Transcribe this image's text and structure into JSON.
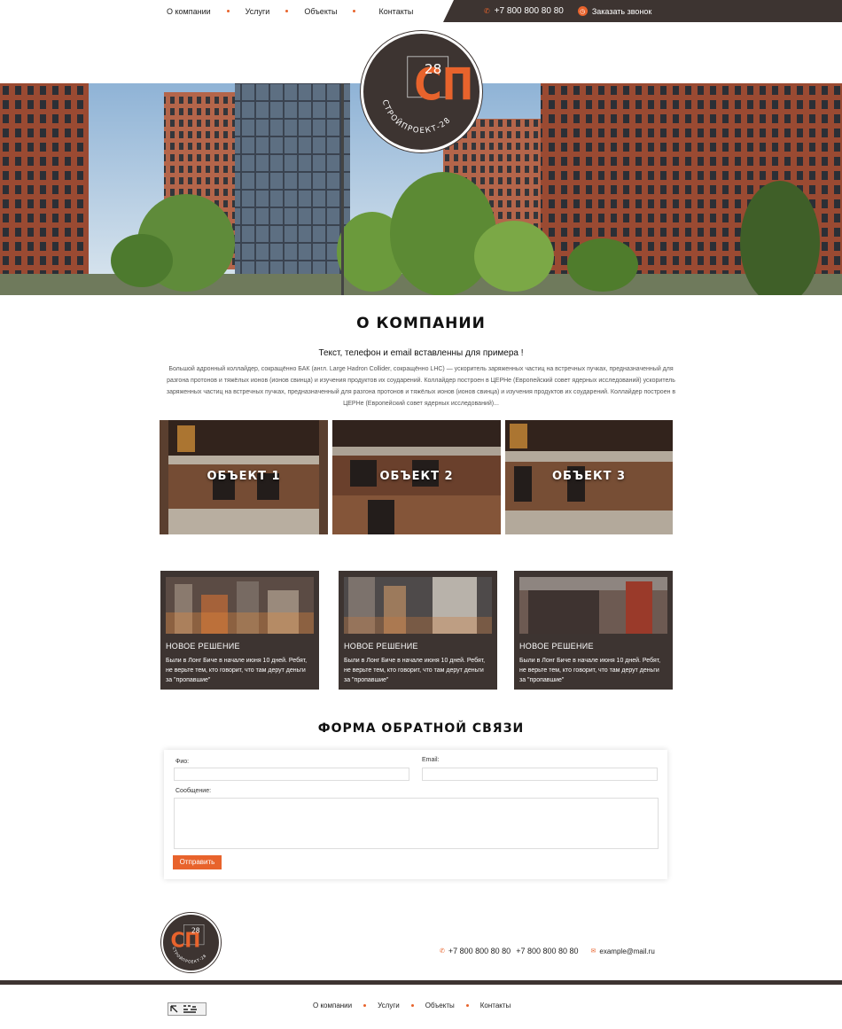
{
  "header": {
    "nav": [
      "О компании",
      "Услуги",
      "Объекты",
      "Контакты"
    ],
    "phone": "+7 800 800 80 80",
    "callback": "Заказать звонок"
  },
  "logo": {
    "letters": "СП",
    "number": "28",
    "ring_text": "СТРОЙПРОЕКТ-28"
  },
  "about": {
    "title": "О КОМПАНИИ",
    "subtitle": "Текст, телефон и email вставленны для примера !",
    "text": "Большой адронный коллайдер, сокращённо БАК (англ. Large Hadron Collider, сокращённо LHC) — ускоритель заряженных частиц на встречных пучках, предназначенный для разгона протонов и тяжёлых ионов (ионов свинца) и изучения продуктов их соударений. Коллайдер построен в ЦЕРНе (Европейский совет ядерных исследований) ускоритель заряженных частиц на встречных пучках, предназначенный для разгона протонов и тяжёлых ионов (ионов свинца) и изучения продуктов их соударений. Коллайдер построен в ЦЕРНе (Европейский совет ядерных исследований)..."
  },
  "objects": [
    "ОБЪЕКТ 1",
    "ОБЪЕКТ 2",
    "ОБЪЕКТ 3"
  ],
  "cards": [
    {
      "title": "НОВОЕ РЕШЕНИЕ",
      "text": "Были в Лонг Биче в начале июня 10 дней. Ребят, не верьте тем, кто говорит, что там дерут деньги за  \"пропавшие\""
    },
    {
      "title": "НОВОЕ РЕШЕНИЕ",
      "text": "Были в Лонг Биче в начале июня 10 дней. Ребят, не верьте тем, кто говорит, что там дерут деньги за  \"пропавшие\""
    },
    {
      "title": "НОВОЕ РЕШЕНИЕ",
      "text": "Были в Лонг Биче в начале июня 10 дней. Ребят, не верьте тем, кто говорит, что там дерут деньги за  \"пропавшие\""
    }
  ],
  "form": {
    "title": "ФОРМА ОБРАТНОЙ СВЯЗИ",
    "name_label": "Фио:",
    "email_label": "Email:",
    "message_label": "Сообщение:",
    "submit": "Отправить"
  },
  "footer": {
    "phone1": "+7 800 800 80 80",
    "phone2": "+7 800 800 80 80",
    "email": "example@mail.ru",
    "nav": [
      "О компании",
      "Услуги",
      "Объекты",
      "Контакты"
    ]
  },
  "colors": {
    "accent": "#e8632c",
    "dark": "#3d3431"
  }
}
